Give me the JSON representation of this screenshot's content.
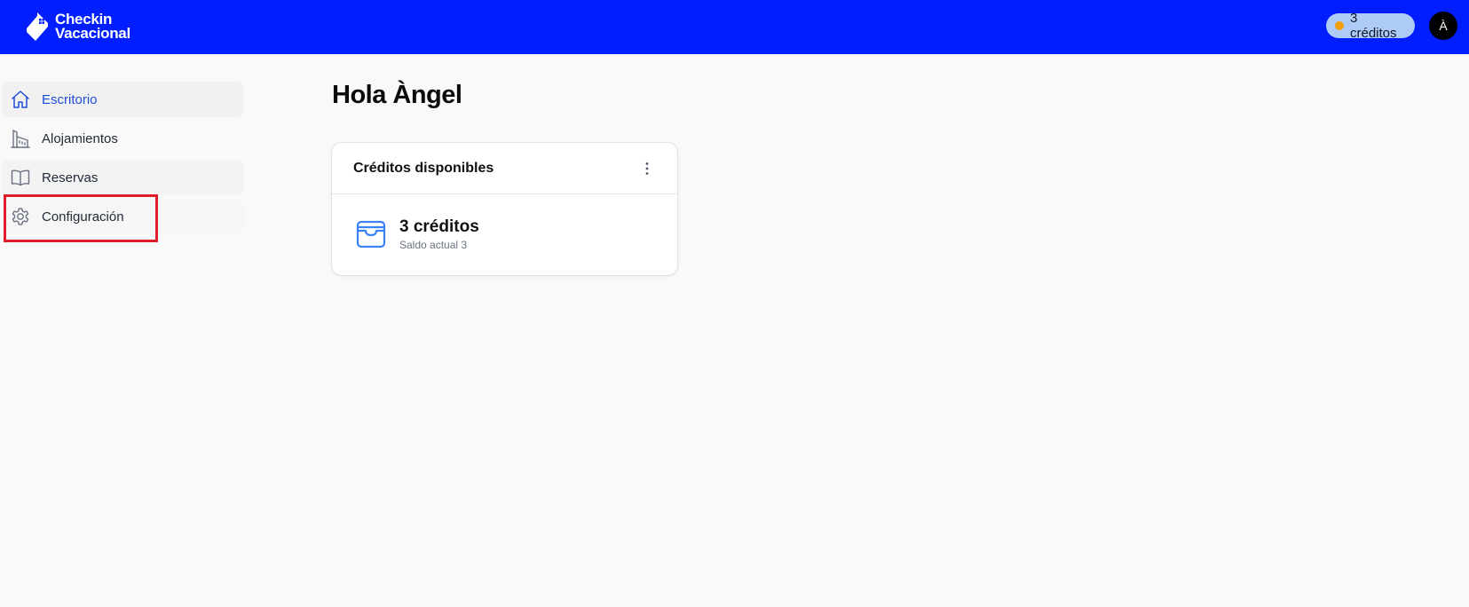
{
  "colors": {
    "topbar": "#001eff",
    "credits_pill": "#aecaf6",
    "credits_dot": "#f59e0b",
    "active_nav_text": "#1d4ed8",
    "highlight": "#e11d2a"
  },
  "header": {
    "logo": {
      "line1": "Checkin",
      "line2": "Vacacional",
      "icon": "house-tag-logo-icon"
    },
    "credits_badge": "3 créditos",
    "avatar_initial": "À"
  },
  "sidebar": {
    "items": [
      {
        "label": "Escritorio",
        "icon": "home-icon",
        "active": true
      },
      {
        "label": "Alojamientos",
        "icon": "building-icon",
        "active": false
      },
      {
        "label": "Reservas",
        "icon": "book-icon",
        "active": false
      },
      {
        "label": "Configuración",
        "icon": "gear-icon",
        "active": false,
        "highlighted": true
      }
    ]
  },
  "main": {
    "greeting": "Hola Àngel",
    "credits_card": {
      "title": "Créditos disponibles",
      "menu_icon": "kebab-menu-icon",
      "wallet_icon": "wallet-icon",
      "amount": "3 créditos",
      "subtitle": "Saldo actual 3"
    }
  }
}
